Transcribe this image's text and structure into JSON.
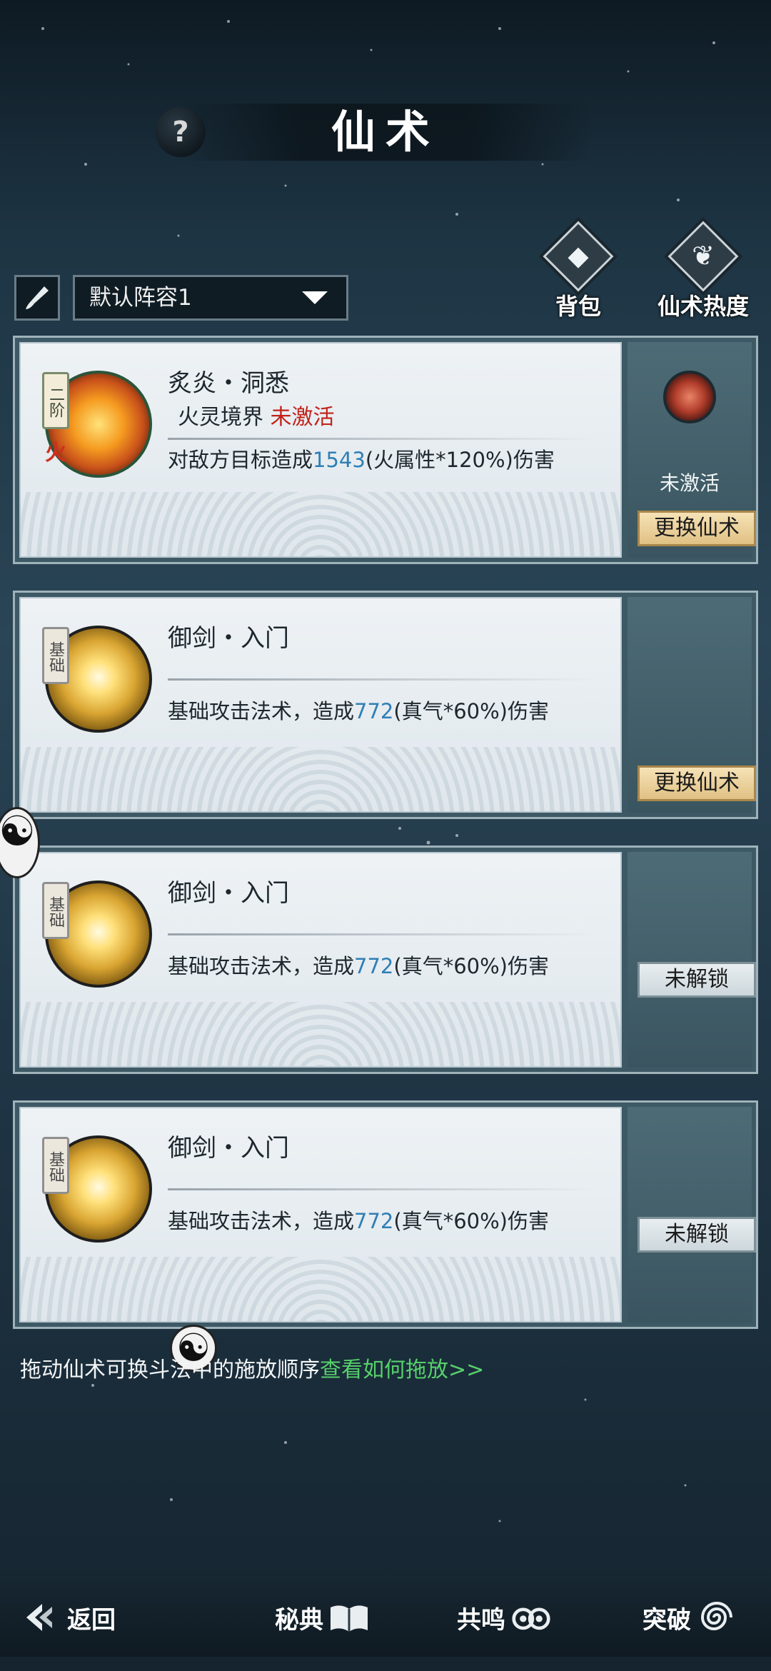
{
  "header": {
    "title": "仙术",
    "help_label": "?"
  },
  "controls": {
    "formation_selected": "默认阵容1",
    "bag_label": "背包",
    "popularity_label": "仙术热度"
  },
  "skills": [
    {
      "rank": "二阶",
      "element": "火",
      "name": "炙炎・洞悉",
      "realm_label": "火灵境界",
      "realm_status": "未激活",
      "desc_prefix": "对敌方目标造成",
      "desc_value": "1543",
      "desc_suffix": "(火属性*120%)伤害",
      "side_status": "未激活",
      "action_label": "更换仙术"
    },
    {
      "rank": "基础",
      "name": "御剑・入门",
      "desc_prefix": "基础攻击法术，造成",
      "desc_value": "772",
      "desc_suffix": "(真气*60%)伤害",
      "action_label": "更换仙术"
    },
    {
      "rank": "基础",
      "name": "御剑・入门",
      "desc_prefix": "基础攻击法术，造成",
      "desc_value": "772",
      "desc_suffix": "(真气*60%)伤害",
      "action_label": "未解锁"
    },
    {
      "rank": "基础",
      "name": "御剑・入门",
      "desc_prefix": "基础攻击法术，造成",
      "desc_value": "772",
      "desc_suffix": "(真气*60%)伤害",
      "action_label": "未解锁"
    }
  ],
  "hint": {
    "text": "拖动仙术可换斗法中的施放顺序",
    "link": "查看如何拖放>>"
  },
  "nav": {
    "back": "返回",
    "manual": "秘典",
    "resonance": "共鸣",
    "breakthrough": "突破"
  },
  "colors": {
    "accent_value": "#2e7fb5",
    "inactive": "#c1221a",
    "link": "#56d06b"
  }
}
